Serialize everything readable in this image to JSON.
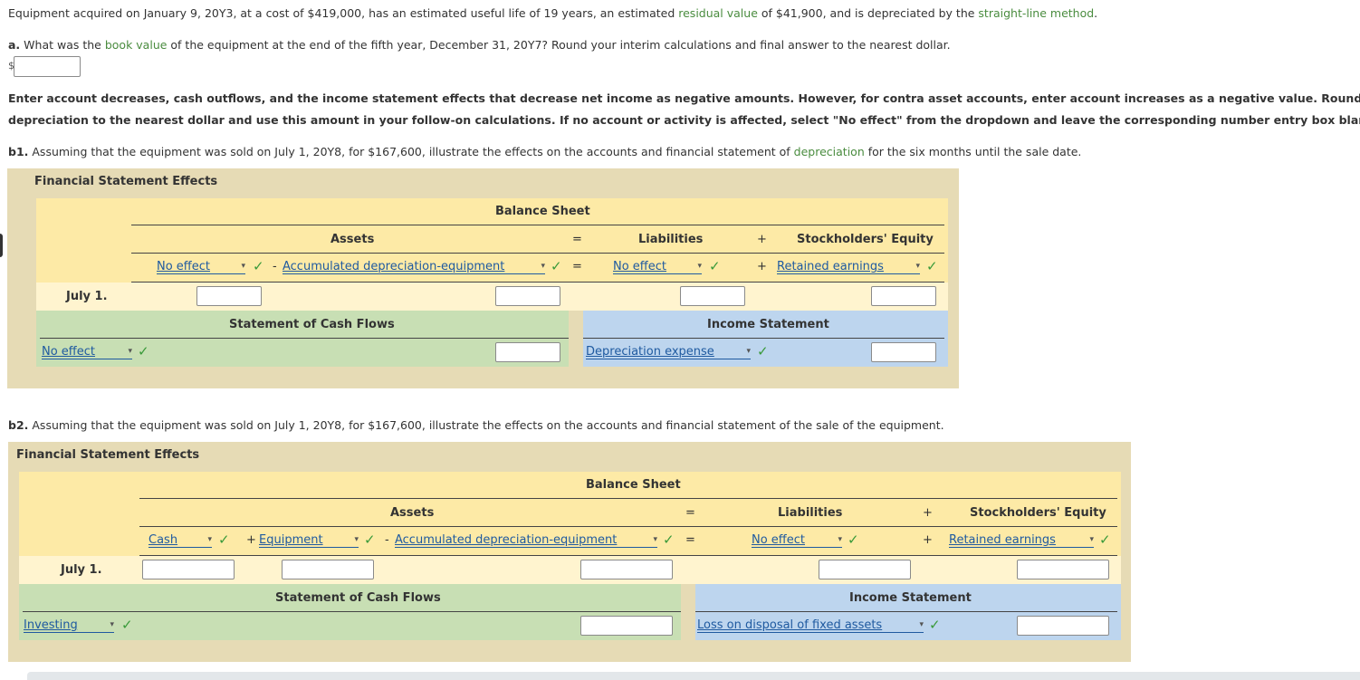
{
  "intro": {
    "p1": "Equipment acquired on January 9, 20Y3, at a cost of $419,000, has an estimated useful life of 19 years, an estimated ",
    "link_residual": "residual value",
    "p2": " of $41,900, and is depreciated by the ",
    "link_sl": "straight-line method",
    "p3": "."
  },
  "qa": {
    "label": "a.",
    "t1": " What was the ",
    "link_bv": "book value",
    "t2": " of the equipment at the end of the fifth year, December 31, 20Y7? Round your interim calculations and final answer to the nearest dollar.",
    "dollar": "$"
  },
  "instructions": {
    "line1": "Enter account decreases, cash outflows, and the income statement effects that decrease net income as negative amounts. However, for contra asset accounts, enter account increases as a negative value. Round annual",
    "line2": "depreciation to the nearest dollar and use this amount in your follow-on calculations. If no account or activity is affected, select \"No effect\" from the dropdown and leave the corresponding number entry box blank."
  },
  "qb1": {
    "label": "b1.",
    "t1": " Assuming that the equipment was sold on July 1, 20Y8, for $167,600, illustrate the effects on the accounts and financial statement of ",
    "link_dep": "depreciation",
    "t2": " for the six months until the sale date."
  },
  "qb2": {
    "label": "b2.",
    "t1": " Assuming that the equipment was sold on July 1, 20Y8, for $167,600, illustrate the effects on the accounts and financial statement of the sale of the equipment."
  },
  "fse_title": "Financial Statement Effects",
  "balance_sheet": "Balance Sheet",
  "assets": "Assets",
  "liabilities": "Liabilities",
  "equity": "Stockholders' Equity",
  "scf": "Statement of Cash Flows",
  "is": "Income Statement",
  "row_label": "July 1.",
  "ops": {
    "eq": "=",
    "plus": "+",
    "minus": "-"
  },
  "check": "✓",
  "arrow": "▾",
  "t1": {
    "asset1": "No effect",
    "asset2": "Accumulated depreciation-equipment",
    "liab": "No effect",
    "equity": "Retained earnings",
    "cash": "No effect",
    "income": "Depreciation expense"
  },
  "t2": {
    "asset1": "Cash",
    "asset2": "Equipment",
    "asset3": "Accumulated depreciation-equipment",
    "liab": "No effect",
    "equity": "Retained earnings",
    "cash": "Investing",
    "income": "Loss on disposal of fixed assets"
  },
  "colors": {
    "outer": "#e6dbb5",
    "yellow": "#fdeaa6",
    "row": "#fff4cf",
    "green": "#c8dfb4",
    "blue": "#bdd5ee",
    "link": "#4a8c3f"
  }
}
